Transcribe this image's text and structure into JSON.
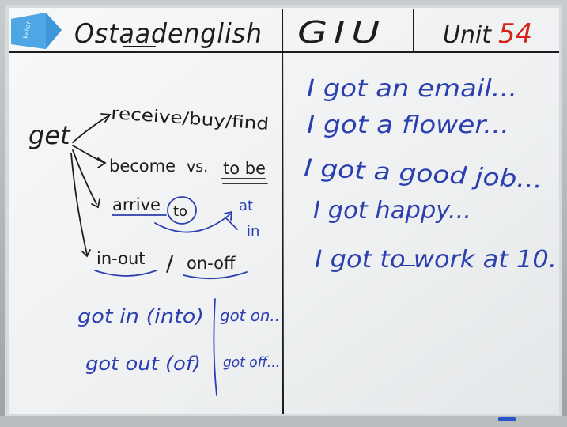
{
  "header": {
    "brand": "Ostaadenglish",
    "course": "GIU",
    "unit_prefix": "Unit",
    "unit_number": "54",
    "eraser_label": "kallar"
  },
  "left_panel": {
    "root_word": "get",
    "meaning_1": "receive/buy/find",
    "meaning_2_prefix": "become",
    "meaning_2_vs": "vs.",
    "meaning_2_contrast": "to be",
    "meaning_3": "arrive",
    "meaning_3_prep": "to",
    "meaning_3_alt_1": "at",
    "meaning_3_alt_2": "in",
    "meaning_4_a": "in-out",
    "meaning_4_sep": "/",
    "meaning_4_b": "on-off",
    "phrase_1": "got in (into)",
    "phrase_2": "got out (of)",
    "phrase_3": "got on..",
    "phrase_4": "got off..."
  },
  "right_panel": {
    "sentences": [
      "I got an email...",
      "I got a flower...",
      "I got a good job...",
      "I got happy...",
      "I got to work at 10."
    ]
  },
  "colors": {
    "black_ink": "#1d1d1f",
    "blue_ink": "#2b3fae",
    "red_ink": "#d4241c",
    "board": "#f3f5f6",
    "eraser": "#3f96d8"
  }
}
